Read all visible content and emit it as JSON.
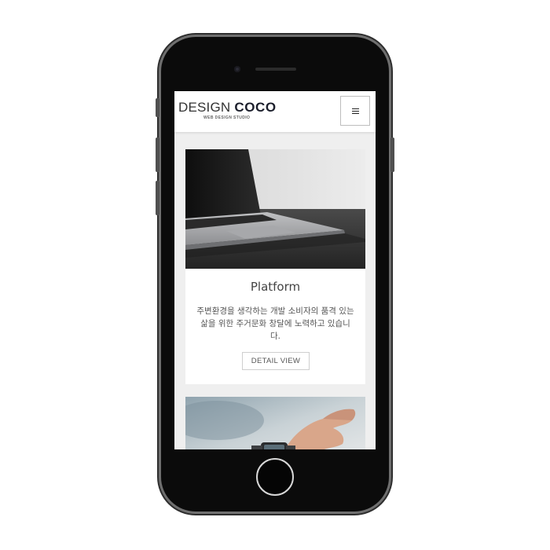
{
  "header": {
    "logo_light": "DESIGN ",
    "logo_bold": "COCO",
    "logo_tagline": "WEB DESIGN STUDIO",
    "menu_icon": "hamburger-menu-icon"
  },
  "cards": [
    {
      "image": "laptop-photo",
      "title": "Platform",
      "description": "주변환경을 생각하는 개발 소비자의 품격 있는 삶을 위한 주거문화 창달에 노력하고 있습니다.",
      "button_label": "DETAIL VIEW"
    },
    {
      "image": "smartwatch-photo"
    }
  ],
  "colors": {
    "phone_body": "#0b0b0b",
    "phone_frame": "#6f6f6f",
    "screen_background": "#efefef",
    "logo_bold": "#1b1e2b",
    "text": "#444444"
  }
}
